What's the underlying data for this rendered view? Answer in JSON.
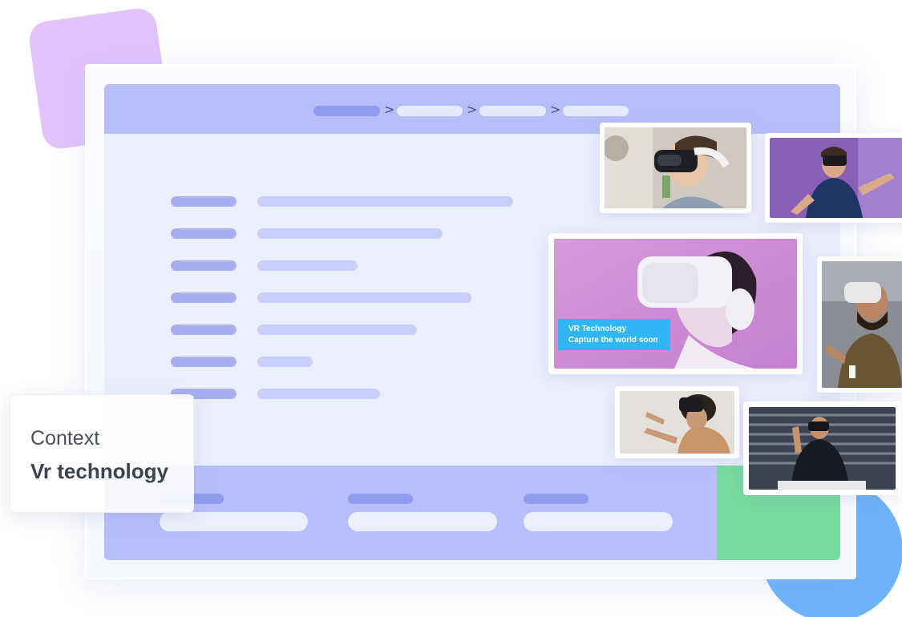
{
  "context_card": {
    "label": "Context",
    "value": "Vr technology"
  },
  "featured_image": {
    "caption_line1": "VR Technology",
    "caption_line2": "Capture the world soon"
  },
  "breadcrumb": {
    "separators": [
      ">",
      ">",
      ">"
    ]
  },
  "colors": {
    "accent_purple": "#b6bffc",
    "accent_green": "#78dc9e",
    "caption_blue": "#30b7f3",
    "deco_lilac": "#e3c3fb",
    "deco_blue": "#6eb4fb"
  },
  "icons": [
    "chevron-right-icon"
  ]
}
